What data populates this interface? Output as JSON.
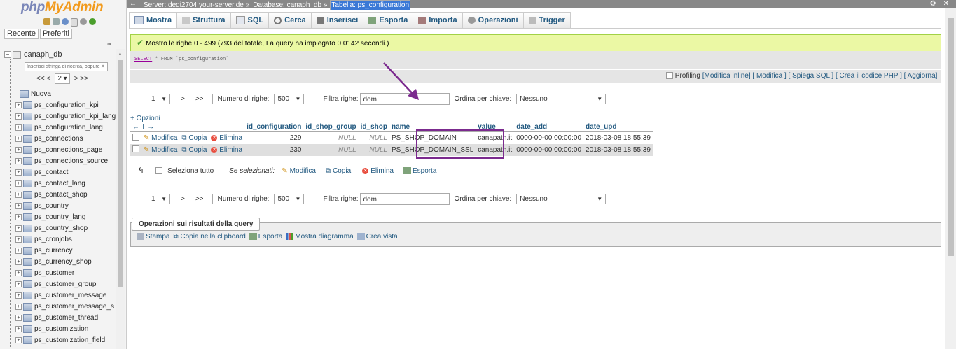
{
  "nav": {
    "logo_php": "php",
    "logo_myadmin": "MyAdmin",
    "tab_recent": "Recente",
    "tab_favorites": "Preferiti",
    "database": "canaph_db",
    "filter_placeholder": "Inserisci stringa di ricerca, oppure X",
    "pager_prev": "<< <",
    "pager_page": "2",
    "pager_next": "> >>",
    "new_label": "Nuova",
    "tables": [
      "ps_configuration_kpi",
      "ps_configuration_kpi_lang",
      "ps_configuration_lang",
      "ps_connections",
      "ps_connections_page",
      "ps_connections_source",
      "ps_contact",
      "ps_contact_lang",
      "ps_contact_shop",
      "ps_country",
      "ps_country_lang",
      "ps_country_shop",
      "ps_cronjobs",
      "ps_currency",
      "ps_currency_shop",
      "ps_customer",
      "ps_customer_group",
      "ps_customer_message",
      "ps_customer_message_s",
      "ps_customer_thread",
      "ps_customization",
      "ps_customization_field"
    ]
  },
  "breadcrumb": {
    "server": "Server: dedi2704.your-server.de »",
    "database": "Database: canaph_db »",
    "table": "Tabella: ps_configuration"
  },
  "tabs": [
    "Mostra",
    "Struttura",
    "SQL",
    "Cerca",
    "Inserisci",
    "Esporta",
    "Importa",
    "Operazioni",
    "Trigger"
  ],
  "success_msg": "Mostro le righe 0 - 499 (793 del totale, La query ha impiegato 0.0142 secondi.)",
  "sql": {
    "keyword": "SELECT",
    "rest": "* FROM `ps_configuration`"
  },
  "profiling": {
    "label": "Profiling",
    "links": "[Modifica inline] [ Modifica ] [ Spiega SQL ] [ Crea il codice PHP ] [ Aggiorna]"
  },
  "navigation": {
    "page": "1",
    "next": ">",
    "last": ">>",
    "rows_label": "Numero di righe:",
    "rows_value": "500",
    "filter_label": "Filtra righe:",
    "filter_value_top": "dom",
    "filter_value_bottom": "dom",
    "sort_label": "Ordina per chiave:",
    "sort_value": "Nessuno"
  },
  "options_link": "+ Opzioni",
  "arrows": "← T →",
  "columns": [
    "id_configuration",
    "id_shop_group",
    "id_shop",
    "name",
    "value",
    "date_add",
    "date_upd"
  ],
  "actions": {
    "edit": "Modifica",
    "copy": "Copia",
    "delete": "Elimina"
  },
  "rows": [
    {
      "id": "229",
      "group": "NULL",
      "shop": "NULL",
      "name": "PS_SHOP_DOMAIN",
      "value": "canapath.it",
      "date_add": "0000-00-00 00:00:00",
      "date_upd": "2018-03-08 18:55:39"
    },
    {
      "id": "230",
      "group": "NULL",
      "shop": "NULL",
      "name": "PS_SHOP_DOMAIN_SSL",
      "value": "canapath.it",
      "date_add": "0000-00-00 00:00:00",
      "date_upd": "2018-03-08 18:55:39"
    }
  ],
  "with_selected": {
    "select_all": "Seleziona tutto",
    "label": "Se selezionati:",
    "edit": "Modifica",
    "copy": "Copia",
    "delete": "Elimina",
    "export": "Esporta"
  },
  "query_ops": {
    "legend": "Operazioni sui risultati della query",
    "print": "Stampa",
    "copy_clipboard": "Copia nella clipboard",
    "export": "Esporta",
    "chart": "Mostra diagramma",
    "view": "Crea vista"
  },
  "colors": {
    "link": "#235a81",
    "success_bg": "#ebf8a4",
    "highlight": "#7b2a8e"
  }
}
